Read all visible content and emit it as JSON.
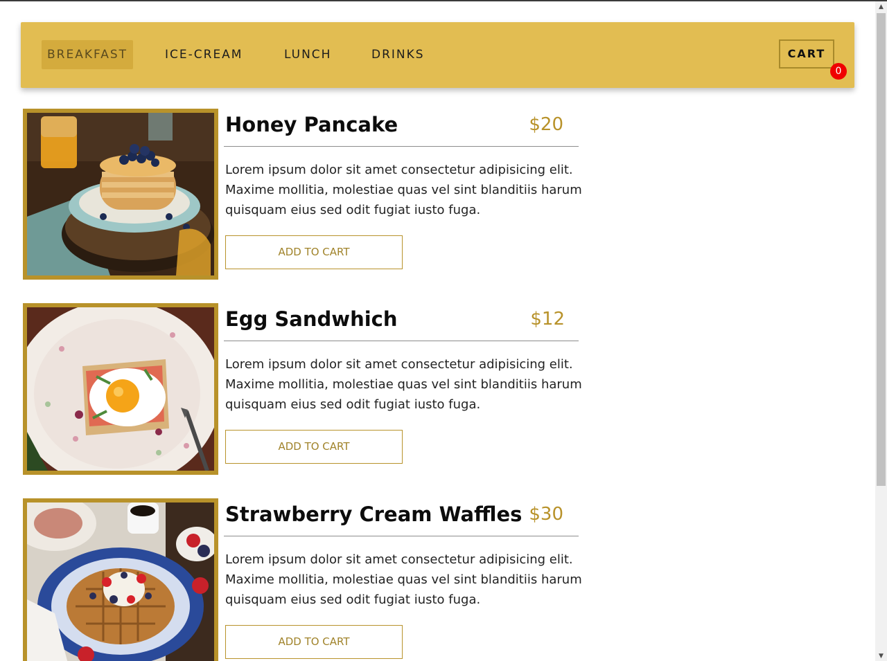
{
  "nav": {
    "items": [
      {
        "label": "BREAKFAST",
        "active": true
      },
      {
        "label": "ICE-CREAM",
        "active": false
      },
      {
        "label": "LUNCH",
        "active": false
      },
      {
        "label": "DRINKS",
        "active": false
      }
    ],
    "cart_label": "CART",
    "cart_count": "0"
  },
  "menu": {
    "items": [
      {
        "title": "Honey Pancake",
        "price": "$20",
        "description": "Lorem ipsum dolor sit amet consectetur adipisicing elit. Maxime mollitia, molestiae quas vel sint blanditiis harum quisquam eius sed odit fugiat iusto fuga.",
        "button_label": "ADD TO CART",
        "image": "honey-pancake-photo"
      },
      {
        "title": "Egg Sandwhich",
        "price": "$12",
        "description": "Lorem ipsum dolor sit amet consectetur adipisicing elit. Maxime mollitia, molestiae quas vel sint blanditiis harum quisquam eius sed odit fugiat iusto fuga.",
        "button_label": "ADD TO CART",
        "image": "egg-sandwich-photo"
      },
      {
        "title": "Strawberry Cream Waffles",
        "price": "$30",
        "description": "Lorem ipsum dolor sit amet consectetur adipisicing elit. Maxime mollitia, molestiae quas vel sint blanditiis harum quisquam eius sed odit fugiat iusto fuga.",
        "button_label": "ADD TO CART",
        "image": "strawberry-waffles-photo"
      }
    ]
  },
  "colors": {
    "navbar_bg": "#e2bd52",
    "accent_gold": "#b8922a",
    "badge_red": "#f00000"
  }
}
